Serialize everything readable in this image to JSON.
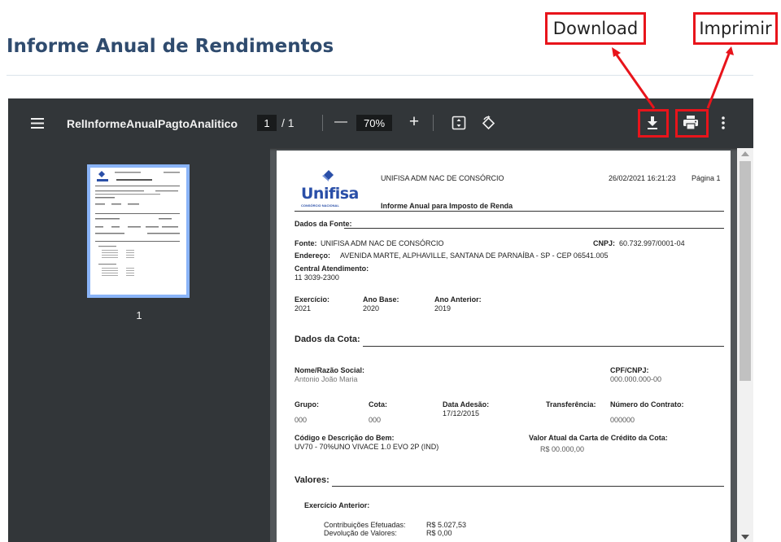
{
  "page": {
    "title": "Informe Anual de Rendimentos"
  },
  "callouts": {
    "download": "Download",
    "print": "Imprimir"
  },
  "toolbar": {
    "doc_name": "RelInformeAnualPagtoAnalitico",
    "current_page": "1",
    "total_pages": "/ 1",
    "zoom": "70%",
    "zoom_out": "—",
    "zoom_in": "+"
  },
  "sidebar": {
    "thumbnail_label": "1"
  },
  "document": {
    "company": "UNIFISA ADM NAC DE CONSÓRCIO",
    "datetime": "26/02/2021 16:21:23",
    "page_label": "Página 1",
    "logo_text": "Unifisa",
    "logo_sub": "CONSÓRCIO NACIONAL",
    "report_title": "Informe Anual para Imposto de Renda",
    "sec_fonte": "Dados da Fonte:",
    "fonte_label": "Fonte:",
    "fonte_value": "UNIFISA ADM NAC DE CONSÓRCIO",
    "cnpj_label": "CNPJ:",
    "cnpj_value": "60.732.997/0001-04",
    "endereco_label": "Endereço:",
    "endereco_value": "AVENIDA  MARTE,  ALPHAVILLE, SANTANA DE PARNAÍBA - SP - CEP 06541.005",
    "central_label": "Central Atendimento:",
    "central_value": "11 3039-2300",
    "exercicio_label": "Exercício:",
    "exercicio_value": "2021",
    "anobase_label": "Ano Base:",
    "anobase_value": "2020",
    "anoant_label": "Ano Anterior:",
    "anoant_value": "2019",
    "sec_cota": "Dados da Cota:",
    "nome_label": "Nome/Razão Social:",
    "nome_value": "Antonio João Maria",
    "cpf_label": "CPF/CNPJ:",
    "cpf_value": "000.000.000-00",
    "grupo_label": "Grupo:",
    "grupo_value": "000",
    "cota_label": "Cota:",
    "cota_value": "000",
    "adesao_label": "Data Adesão:",
    "adesao_value": "17/12/2015",
    "transf_label": "Transferência:",
    "contrato_label": "Número do Contrato:",
    "contrato_value": "000000",
    "bem_label": "Código e Descrição do Bem:",
    "bem_value": "UV70   - 70%UNO VIVACE 1.0 EVO 2P (IND)",
    "carta_label": "Valor Atual da Carta de Crédito da Cota:",
    "carta_value": "R$ 00.000,00",
    "sec_valores": "Valores:",
    "exant_label": "Exercício Anterior:",
    "contrib_label": "Contribuições Efetuadas:",
    "contrib_value": "R$ 5.027,53",
    "devol_label": "Devolução de Valores:",
    "devol_value": "R$ 0,00"
  },
  "colors": {
    "accent_red": "#e8141b",
    "title_blue": "#2f4b6e",
    "toolbar": "#323639",
    "thumb_border": "#8ab4f8"
  }
}
